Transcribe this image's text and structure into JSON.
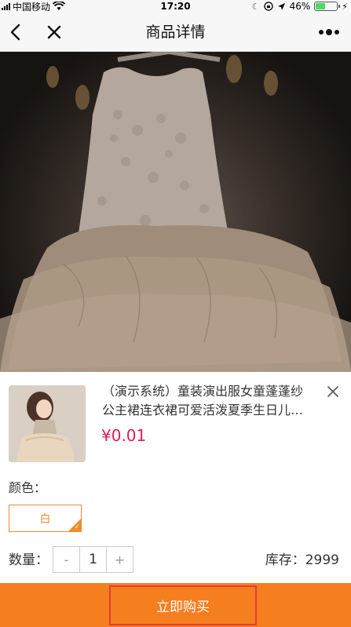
{
  "status_bar": {
    "carrier": "中国移动",
    "time": "17:20",
    "battery": "46%",
    "battery_level": 0.46
  },
  "nav": {
    "title": "商品详情"
  },
  "product": {
    "name_line1": "（演示系统）童装演出服女童蓬蓬纱",
    "name_line2": "公主裙连衣裙可爱活泼夏季生日儿…",
    "price": "¥0.01"
  },
  "spec": {
    "color_label": "颜色：",
    "options": [
      {
        "label": "白",
        "selected": true
      }
    ]
  },
  "quantity": {
    "label": "数量：",
    "minus": "-",
    "value": "1",
    "plus": "+"
  },
  "stock": {
    "label": "库存：2999"
  },
  "action": {
    "buy_label": "立即购买"
  },
  "colors": {
    "accent": "#f57e1f",
    "price": "#e4195b",
    "highlight_border": "#e63a3a"
  }
}
